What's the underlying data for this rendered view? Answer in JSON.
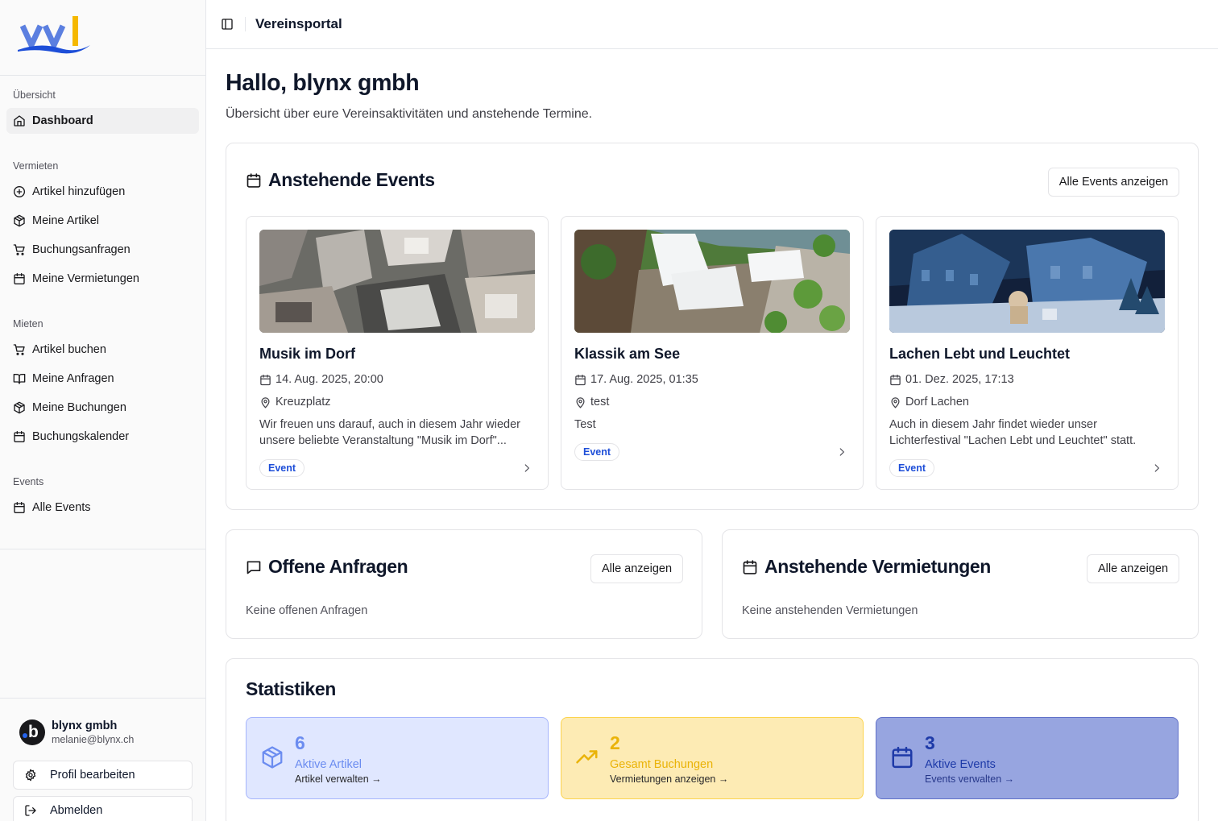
{
  "app": {
    "title": "Vereinsportal",
    "logo_text": "vvl"
  },
  "sidebar": {
    "groups": [
      {
        "label": "Übersicht",
        "items": [
          {
            "label": "Dashboard",
            "icon": "home-icon"
          }
        ]
      },
      {
        "label": "Vermieten",
        "items": [
          {
            "label": "Artikel hinzufügen",
            "icon": "plus-circle-icon"
          },
          {
            "label": "Meine Artikel",
            "icon": "package-icon"
          },
          {
            "label": "Buchungsanfragen",
            "icon": "cart-icon"
          },
          {
            "label": "Meine Vermietungen",
            "icon": "calendar-icon"
          }
        ]
      },
      {
        "label": "Mieten",
        "items": [
          {
            "label": "Artikel buchen",
            "icon": "cart-icon"
          },
          {
            "label": "Meine Anfragen",
            "icon": "book-open-icon"
          },
          {
            "label": "Meine Buchungen",
            "icon": "package-icon"
          },
          {
            "label": "Buchungskalender",
            "icon": "calendar-icon"
          }
        ]
      },
      {
        "label": "Events",
        "items": [
          {
            "label": "Alle Events",
            "icon": "calendar-icon"
          }
        ]
      }
    ],
    "user": {
      "name": "blynx gmbh",
      "email": "melanie@blynx.ch"
    },
    "profile_button": "Profil bearbeiten",
    "logout_button": "Abmelden"
  },
  "main": {
    "greeting": "Hallo, blynx gmbh",
    "subtitle": "Übersicht über eure Vereinsaktivitäten und anstehende Termine.",
    "events_section": {
      "title": "Anstehende Events",
      "button": "Alle Events anzeigen",
      "events": [
        {
          "name": "Musik im Dorf",
          "date": "14. Aug. 2025, 20:00",
          "location": "Kreuzplatz",
          "description": "Wir freuen uns darauf, auch in diesem Jahr wieder unsere beliebte Veranstaltung \"Musik im Dorf\"...",
          "badge": "Event"
        },
        {
          "name": "Klassik am See",
          "date": "17. Aug. 2025, 01:35",
          "location": "test",
          "description": "Test",
          "badge": "Event"
        },
        {
          "name": "Lachen Lebt und Leuchtet",
          "date": "01. Dez. 2025, 17:13",
          "location": "Dorf Lachen",
          "description": "Auch in diesem Jahr findet wieder unser Lichterfestival \"Lachen Lebt und Leuchtet\" statt.",
          "badge": "Event"
        }
      ]
    },
    "requests_section": {
      "title": "Offene Anfragen",
      "button": "Alle anzeigen",
      "empty": "Keine offenen Anfragen"
    },
    "rentals_section": {
      "title": "Anstehende Vermietungen",
      "button": "Alle anzeigen",
      "empty": "Keine anstehenden Vermietungen"
    },
    "stats_section": {
      "title": "Statistiken",
      "stats": [
        {
          "value": "6",
          "label": "Aktive Artikel",
          "link": "Artikel verwalten →",
          "icon": "package-icon",
          "bg": "#e0e7ff",
          "border": "#a5b4fc",
          "accent": "#6b8cf0",
          "link_color": "#27272a"
        },
        {
          "value": "2",
          "label": "Gesamt Buchungen",
          "link": "Vermietungen anzeigen →",
          "icon": "trending-up-icon",
          "bg": "#fdebb4",
          "border": "#fcd34d",
          "accent": "#eab308",
          "link_color": "#27272a"
        },
        {
          "value": "3",
          "label": "Aktive Events",
          "link": "Events verwalten →",
          "icon": "calendar-icon",
          "bg": "#97a5e0",
          "border": "#6070c8",
          "accent": "#1e3aa8",
          "link_color": "#27388a"
        }
      ]
    }
  }
}
